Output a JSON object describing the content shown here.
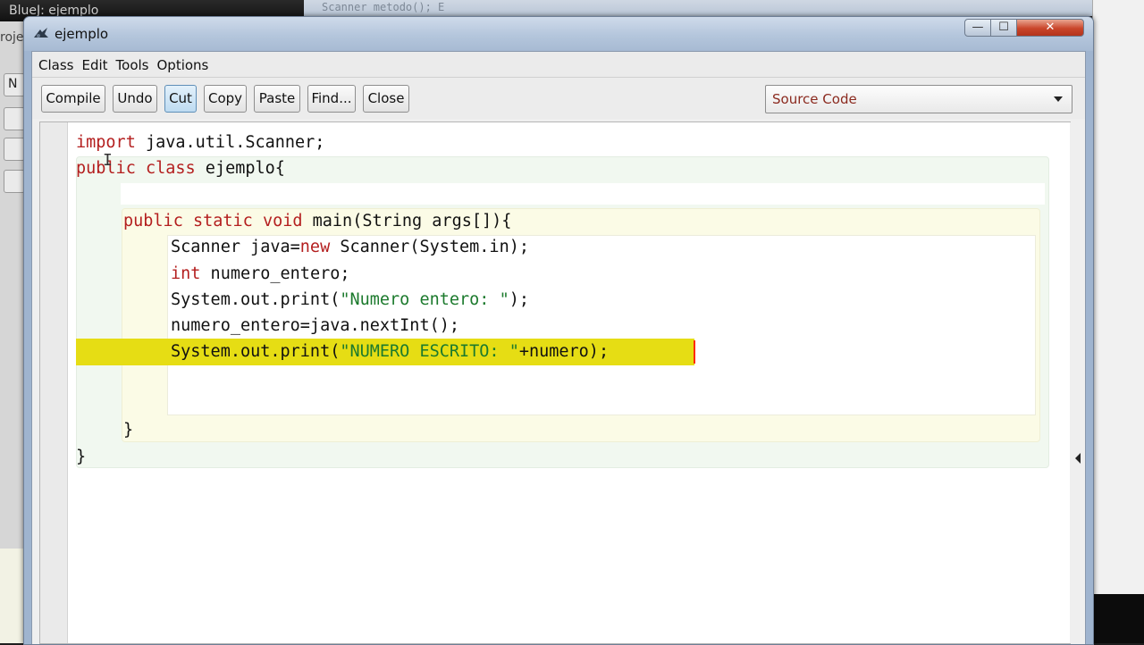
{
  "background": {
    "left_window_title": "BlueJ: ejemplo",
    "left_panel_fragment": "roje",
    "left_panel_button_fragment": "N",
    "top_strip_ghost_text": "Scanner  metodo(); E"
  },
  "window": {
    "title": "ejemplo",
    "controls": {
      "minimize": "—",
      "maximize": "☐",
      "close": "✕"
    }
  },
  "menu": {
    "items": [
      "Class",
      "Edit",
      "Tools",
      "Options"
    ]
  },
  "toolbar": {
    "buttons": [
      "Compile",
      "Undo",
      "Cut",
      "Copy",
      "Paste",
      "Find...",
      "Close"
    ],
    "active_button": "Cut",
    "view_selector": "Source Code"
  },
  "editor": {
    "lines": [
      {
        "indent": 0,
        "tokens": [
          {
            "t": "import",
            "k": "kw"
          },
          {
            "t": " java.util.Scanner;"
          }
        ]
      },
      {
        "indent": 0,
        "tokens": [
          {
            "t": "public",
            "k": "kw"
          },
          {
            "t": " "
          },
          {
            "t": "class",
            "k": "kw"
          },
          {
            "t": " ejemplo{"
          }
        ]
      },
      {
        "indent": 0,
        "tokens": []
      },
      {
        "indent": 1,
        "tokens": [
          {
            "t": "public",
            "k": "kw"
          },
          {
            "t": " "
          },
          {
            "t": "static",
            "k": "kw"
          },
          {
            "t": " "
          },
          {
            "t": "void",
            "k": "kw"
          },
          {
            "t": " main(String args[]){"
          }
        ]
      },
      {
        "indent": 2,
        "tokens": [
          {
            "t": "Scanner java="
          },
          {
            "t": "new",
            "k": "kw"
          },
          {
            "t": " Scanner(System.in);"
          }
        ]
      },
      {
        "indent": 2,
        "tokens": [
          {
            "t": "int",
            "k": "kw"
          },
          {
            "t": " numero_entero;"
          }
        ]
      },
      {
        "indent": 2,
        "tokens": [
          {
            "t": "System.out.print("
          },
          {
            "t": "\"Numero entero: \"",
            "k": "str"
          },
          {
            "t": ");"
          }
        ]
      },
      {
        "indent": 2,
        "tokens": [
          {
            "t": "numero_entero=java.nextInt();"
          }
        ]
      },
      {
        "indent": 2,
        "tokens": [
          {
            "t": "System.out.print("
          },
          {
            "t": "\"NUMERO ESCRITO: \"",
            "k": "str"
          },
          {
            "t": "+numero);"
          }
        ]
      },
      {
        "indent": 2,
        "tokens": []
      },
      {
        "indent": 2,
        "tokens": []
      },
      {
        "indent": 1,
        "tokens": [
          {
            "t": "}"
          }
        ]
      },
      {
        "indent": 0,
        "tokens": [
          {
            "t": "}"
          }
        ]
      }
    ],
    "highlighted_line": 8,
    "colors": {
      "keyword": "#b41f1f",
      "string": "#1c7a2d",
      "highlight": "#e6dd14",
      "caret": "#ff2a00"
    }
  }
}
